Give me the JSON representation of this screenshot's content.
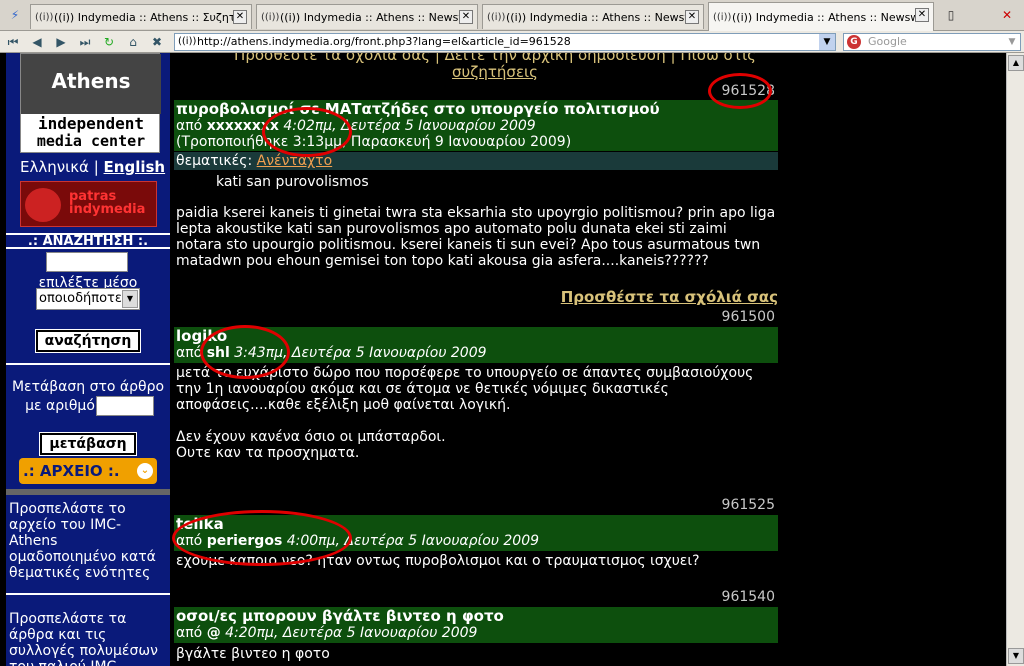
{
  "tabs": [
    {
      "label": "((i)) Indymedia :: Athens :: Συζητή..."
    },
    {
      "label": "((i)) Indymedia :: Athens :: Newsw..."
    },
    {
      "label": "((i)) Indymedia :: Athens :: Newsw..."
    },
    {
      "label": "((i)) Indymedia :: Athens :: Newsw..."
    }
  ],
  "url": "http://athens.indymedia.org/front.php3?lang=el&article_id=961528",
  "search_placeholder": "Google",
  "sidebar": {
    "logo_city": "Athens",
    "logo_line1": "independent",
    "logo_line2": "media center",
    "lang_gr": "Ελληνικά",
    "lang_sep": "|",
    "lang_en": "English",
    "patras": "patras indymedia",
    "search_title": ".: ΑΝΑΖΗΤΗΣΗ :.",
    "choose_medium": "επιλέξτε μέσο",
    "medium_value": "οποιοδήποτε",
    "search_button": "αναζήτηση",
    "goto_label_1": "Μετάβαση στο άρθρο",
    "goto_label_2": "με αριθμό",
    "goto_button": "μετάβαση",
    "archive_title": ".: ΑΡΧΕΙΟ :.",
    "archive_text_1": "Προσπελάστε το αρχείο του IMC-Athens ομαδοποιημένο κατά θεματικές ενότητες",
    "archive_text_2": "Προσπελάστε τα άρθρα και τις συλλογές πολυμέσων του παλιού IMC"
  },
  "main": {
    "top_links_1": "Προσθέστε τα σχόλιά σας | Δείτε την αρχική δημοσίευση | Πίσω στις",
    "top_links_2": "συζητήσεις",
    "articles": [
      {
        "number": "961528",
        "title": "πυροβολισμοί σε ΜΑΤατζήδες στο υπουργείο πολιτισμού",
        "by": "από",
        "author": "xxxxxxxx",
        "date": "4:02πμ, Δευτέρα 5 Ιανουαρίου 2009",
        "modified": "(Τροποποιήθηκε 3:13μμ, Παρασκευή 9 Ιανουαρίου 2009)",
        "topic_label": "θεματικές:",
        "topic": "Ανένταχτο",
        "summary": "kati san purovolismos",
        "body": "paidia kserei kaneis ti ginetai twra sta eksarhia sto upoyrgio politismou? prin apo liga lepta akoustike kati san purovolismos apo automato polu dunata ekei sti zaimi notara sto upourgio politismou. kserei kaneis ti sun evei? Apo tous asurmatous twn matadwn pou ehoun gemisei ton topo kati akousa gia asfera....kaneis??????",
        "add_comment": "Προσθέστε τα σχόλιά σας"
      },
      {
        "number": "961500",
        "title": "logiko",
        "by": "από",
        "author": "shl",
        "date": "3:43πμ, Δευτέρα 5 Ιανουαρίου 2009",
        "body": "μετά το ευχάριστο δώρο που πορσέφερε το υπουργείο σε άπαντες συμβασιούχους την 1η ιανουαρίου ακόμα και σε άτομα νε θετικές νόμιμες δικαστικές αποφάσεις....καθε εξέλιξη μοθ φαίνεται λογική.",
        "body2": "Δεν έχουν κανένα όσιο οι μπάσταρδοι.",
        "body3": "Ουτε καν τα προσχηματα."
      },
      {
        "number": "961525",
        "title": "telika",
        "by": "από",
        "author": "periergos",
        "date": "4:00πμ, Δευτέρα 5 Ιανουαρίου 2009",
        "body": "εχουμε καποιο νεο? ηταν οντως πυροβολισμοι και ο τραυματισμος ισχυει?"
      },
      {
        "number": "961540",
        "title": "οσοι/ες μπορουν βγάλτε βιντεο η φοτο",
        "by": "από",
        "author": "@",
        "date": "4:20πμ, Δευτέρα 5 Ιανουαρίου 2009",
        "body": "βγάλτε βιντεο η φοτο"
      }
    ]
  },
  "colors": {
    "article_header": "#0d4f0d",
    "sidebar": "#0a1a7a",
    "link": "#d8c27a",
    "annotation": "#e00000"
  }
}
